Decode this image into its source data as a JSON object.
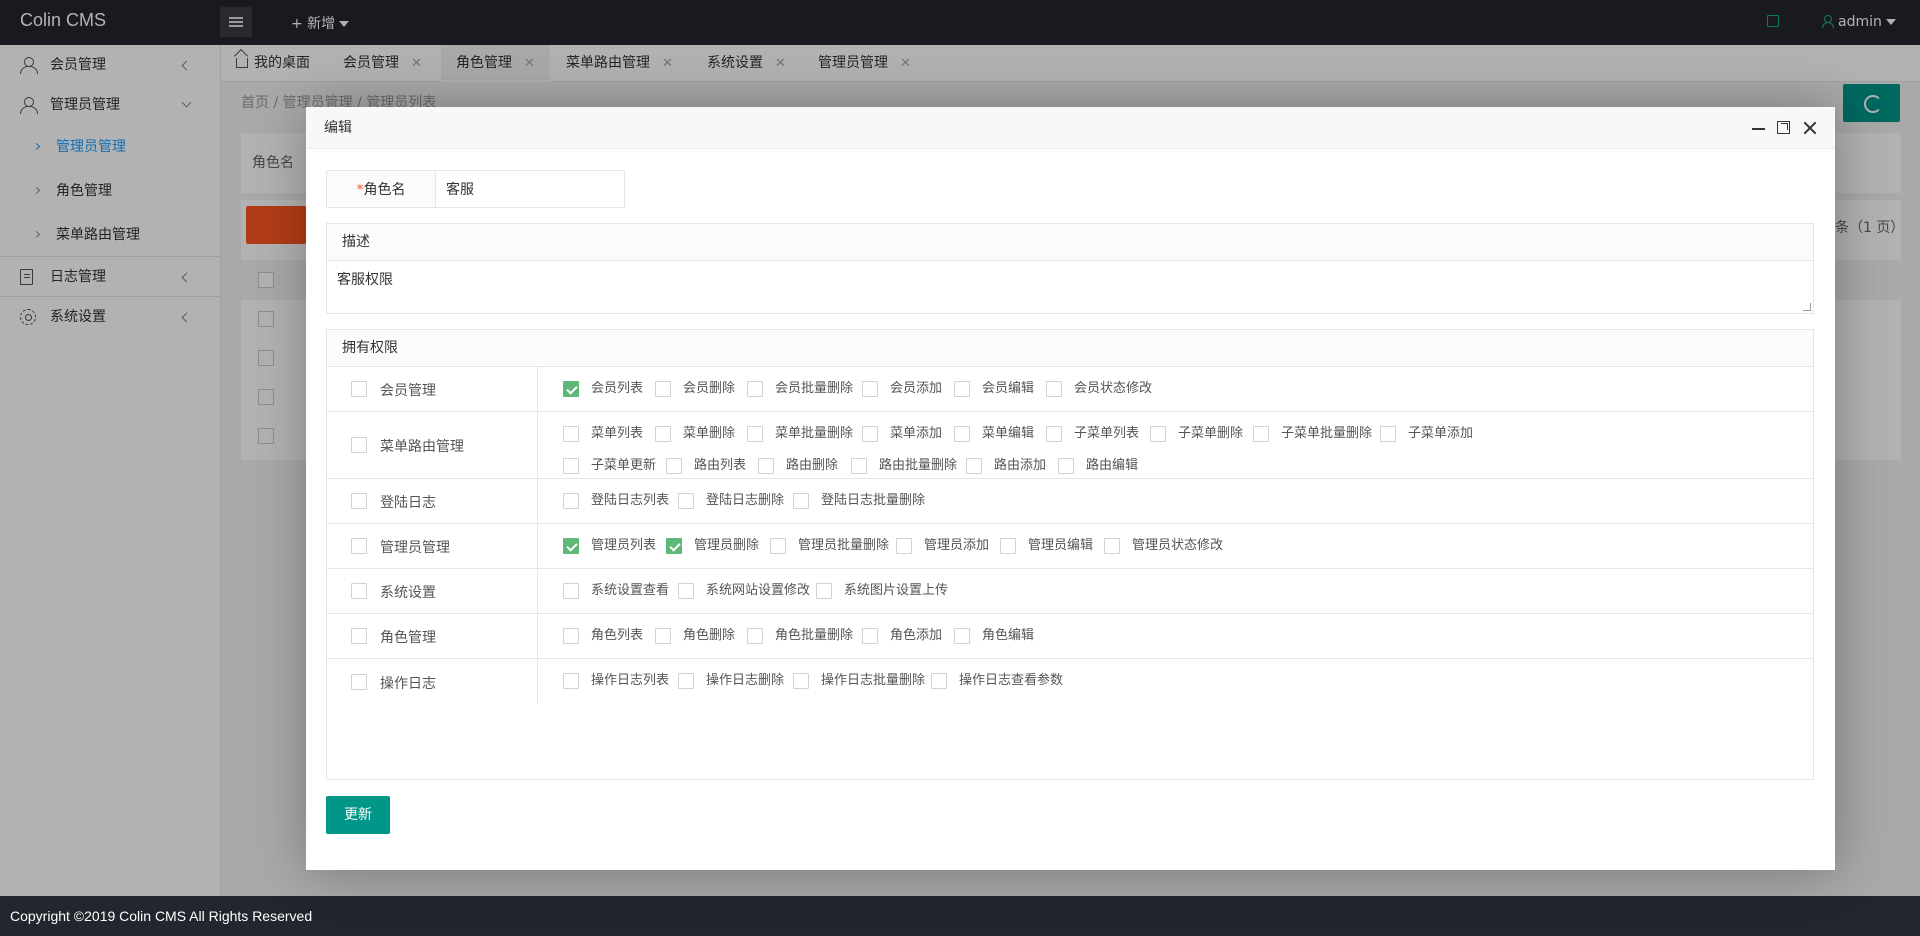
{
  "header": {
    "logo": "Colin CMS",
    "add_new": "+ 新增",
    "user": "admin"
  },
  "sidebar": {
    "items": [
      {
        "label": "会员管理"
      },
      {
        "label": "管理员管理"
      },
      {
        "label": "日志管理"
      },
      {
        "label": "系统设置"
      }
    ],
    "sub_items": [
      {
        "label": "管理员管理"
      },
      {
        "label": "角色管理"
      },
      {
        "label": "菜单路由管理"
      }
    ]
  },
  "tabs": [
    {
      "label": "我的桌面"
    },
    {
      "label": "会员管理",
      "close": "✕"
    },
    {
      "label": "角色管理",
      "close": "✕"
    },
    {
      "label": "菜单路由管理",
      "close": "✕"
    },
    {
      "label": "系统设置",
      "close": "✕"
    },
    {
      "label": "管理员管理",
      "close": "✕"
    }
  ],
  "background": {
    "breadcrumb": "首页   /   管理员管理   /   管理员列表",
    "filter_label": "角色名",
    "page_info": "条（1 页）"
  },
  "modal": {
    "title": "编辑",
    "role_name_label": "角色名",
    "required_mark": "*",
    "role_name_value": "客服",
    "desc_label": "描述",
    "desc_value": "客服权限",
    "perm_label": "拥有权限",
    "update_button": "更新",
    "groups": [
      {
        "name": "会员管理",
        "checked": false,
        "options": [
          {
            "label": "会员列表",
            "checked": true
          },
          {
            "label": "会员删除",
            "checked": false
          },
          {
            "label": "会员批量删除",
            "checked": false
          },
          {
            "label": "会员添加",
            "checked": false
          },
          {
            "label": "会员编辑",
            "checked": false
          },
          {
            "label": "会员状态修改",
            "checked": false
          }
        ]
      },
      {
        "name": "菜单路由管理",
        "checked": false,
        "options": [
          {
            "label": "菜单列表",
            "checked": false
          },
          {
            "label": "菜单删除",
            "checked": false
          },
          {
            "label": "菜单批量删除",
            "checked": false
          },
          {
            "label": "菜单添加",
            "checked": false
          },
          {
            "label": "菜单编辑",
            "checked": false
          },
          {
            "label": "子菜单列表",
            "checked": false
          },
          {
            "label": "子菜单删除",
            "checked": false
          },
          {
            "label": "子菜单批量删除",
            "checked": false
          },
          {
            "label": "子菜单添加",
            "checked": false
          },
          {
            "label": "子菜单更新",
            "checked": false
          },
          {
            "label": "路由列表",
            "checked": false
          },
          {
            "label": "路由删除",
            "checked": false
          },
          {
            "label": "路由批量删除",
            "checked": false
          },
          {
            "label": "路由添加",
            "checked": false
          },
          {
            "label": "路由编辑",
            "checked": false
          }
        ]
      },
      {
        "name": "登陆日志",
        "checked": false,
        "options": [
          {
            "label": "登陆日志列表",
            "checked": false
          },
          {
            "label": "登陆日志删除",
            "checked": false
          },
          {
            "label": "登陆日志批量删除",
            "checked": false
          }
        ]
      },
      {
        "name": "管理员管理",
        "checked": false,
        "options": [
          {
            "label": "管理员列表",
            "checked": true
          },
          {
            "label": "管理员删除",
            "checked": true
          },
          {
            "label": "管理员批量删除",
            "checked": false
          },
          {
            "label": "管理员添加",
            "checked": false
          },
          {
            "label": "管理员编辑",
            "checked": false
          },
          {
            "label": "管理员状态修改",
            "checked": false
          }
        ]
      },
      {
        "name": "系统设置",
        "checked": false,
        "options": [
          {
            "label": "系统设置查看",
            "checked": false
          },
          {
            "label": "系统网站设置修改",
            "checked": false
          },
          {
            "label": "系统图片设置上传",
            "checked": false
          }
        ]
      },
      {
        "name": "角色管理",
        "checked": false,
        "options": [
          {
            "label": "角色列表",
            "checked": false
          },
          {
            "label": "角色删除",
            "checked": false
          },
          {
            "label": "角色批量删除",
            "checked": false
          },
          {
            "label": "角色添加",
            "checked": false
          },
          {
            "label": "角色编辑",
            "checked": false
          }
        ]
      },
      {
        "name": "操作日志",
        "checked": false,
        "options": [
          {
            "label": "操作日志列表",
            "checked": false
          },
          {
            "label": "操作日志删除",
            "checked": false
          },
          {
            "label": "操作日志批量删除",
            "checked": false
          },
          {
            "label": "操作日志查看参数",
            "checked": false
          }
        ]
      }
    ]
  },
  "footer": {
    "text": "Copyright ©2019 Colin CMS All Rights Reserved"
  }
}
